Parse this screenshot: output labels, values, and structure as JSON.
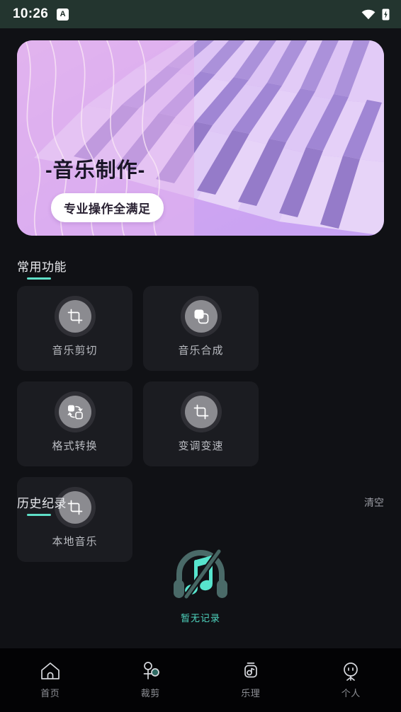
{
  "statusbar": {
    "time": "10:26",
    "badge_letter": "A",
    "wifi_icon": "wifi-icon",
    "battery_icon": "battery-charging-icon",
    "background_color": "#23352f"
  },
  "banner": {
    "title": "-音乐制作-",
    "pill_text": "专业操作全满足",
    "image": "piano-keyboard-illustration",
    "gradient_from": "#e8b9ee",
    "gradient_to": "#c6a4f5"
  },
  "common_functions": {
    "title": "常用功能",
    "accent_color": "#5fdfc8",
    "items": [
      {
        "label": "音乐剪切",
        "icon": "crop-icon"
      },
      {
        "label": "音乐合成",
        "icon": "layers-merge-icon"
      },
      {
        "label": "格式转换",
        "icon": "format-convert-icon"
      },
      {
        "label": "变调变速",
        "icon": "crop-icon"
      },
      {
        "label": "本地音乐",
        "icon": "crop-icon"
      }
    ]
  },
  "history": {
    "title": "历史纪录",
    "clear_label": "清空",
    "accent_color": "#5fdfc8",
    "empty_icon": "headphones-music-note-slash-icon",
    "empty_text": "暂无记录",
    "empty_color": "#4fd6c0"
  },
  "bottom_nav": {
    "background_color": "#030305",
    "items": [
      {
        "label": "首页",
        "icon": "home-icon",
        "active": true
      },
      {
        "label": "裁剪",
        "icon": "scissors-icon",
        "active": false
      },
      {
        "label": "乐理",
        "icon": "music-theory-icon",
        "active": false
      },
      {
        "label": "个人",
        "icon": "person-face-icon",
        "active": false
      }
    ]
  }
}
